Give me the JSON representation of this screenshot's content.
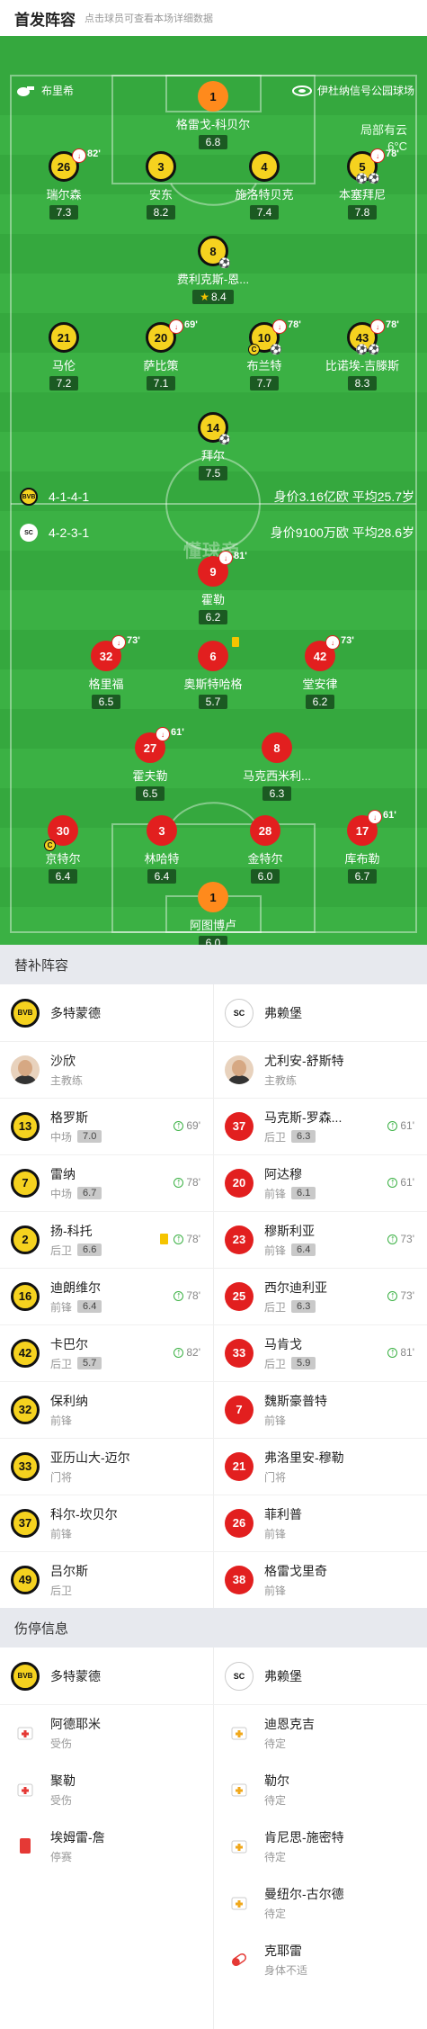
{
  "header": {
    "title": "首发阵容",
    "subtitle": "点击球员可查看本场详细数据"
  },
  "pitch": {
    "home_team": "布里希",
    "venue": "伊杜纳信号公园球场",
    "weather": "局部有云",
    "temperature": "6°C",
    "home_formation": "4-1-4-1",
    "away_formation": "4-2-3-1",
    "home_value": "身价3.16亿欧  平均25.7岁",
    "away_value": "身价9100万欧  平均28.6岁",
    "watermark": "懂球帝"
  },
  "dortmund": [
    {
      "num": "1",
      "name": "格雷戈-科贝尔",
      "rating": "6.8",
      "kind": "gk"
    },
    {
      "num": "26",
      "name": "瑞尔森",
      "rating": "7.3",
      "sub": "82'"
    },
    {
      "num": "3",
      "name": "安东",
      "rating": "8.2"
    },
    {
      "num": "4",
      "name": "施洛特贝克",
      "rating": "7.4"
    },
    {
      "num": "5",
      "name": "本塞拜尼",
      "rating": "7.8",
      "sub": "78'"
    },
    {
      "num": "8",
      "name": "费利克斯-恩...",
      "rating": "8.4"
    },
    {
      "num": "21",
      "name": "马伦",
      "rating": "7.2"
    },
    {
      "num": "20",
      "name": "萨比策",
      "rating": "7.1",
      "sub": "69'"
    },
    {
      "num": "10",
      "name": "布兰特",
      "rating": "7.7",
      "sub": "78'"
    },
    {
      "num": "43",
      "name": "比诺埃-吉滕斯",
      "rating": "8.3",
      "sub": "78'"
    },
    {
      "num": "14",
      "name": "拜尔",
      "rating": "7.5"
    }
  ],
  "freiburg": [
    {
      "num": "9",
      "name": "霍勒",
      "rating": "6.2",
      "sub": "81'"
    },
    {
      "num": "32",
      "name": "格里福",
      "rating": "6.5",
      "sub": "73'"
    },
    {
      "num": "6",
      "name": "奥斯特哈格",
      "rating": "5.7"
    },
    {
      "num": "42",
      "name": "堂安律",
      "rating": "6.2",
      "sub": "73'"
    },
    {
      "num": "27",
      "name": "霍夫勒",
      "rating": "6.5",
      "sub": "61'"
    },
    {
      "num": "8",
      "name": "马克西米利...",
      "rating": "6.3"
    },
    {
      "num": "30",
      "name": "京特尔",
      "rating": "6.4"
    },
    {
      "num": "3",
      "name": "林哈特",
      "rating": "6.4"
    },
    {
      "num": "28",
      "name": "金特尔",
      "rating": "6.0"
    },
    {
      "num": "17",
      "name": "库布勒",
      "rating": "6.7",
      "sub": "61'"
    },
    {
      "num": "1",
      "name": "阿图博卢",
      "rating": "6.0",
      "kind": "gk"
    }
  ],
  "subs_section": {
    "title": "替补阵容",
    "home_team": "多特蒙德",
    "away_team": "弗赖堡"
  },
  "coaches": [
    {
      "name": "沙欣",
      "role": "主教练"
    },
    {
      "name": "尤利安-舒斯特",
      "role": "主教练"
    }
  ],
  "subs_home": [
    {
      "num": "13",
      "name": "格罗斯",
      "pos": "中场",
      "rating": "7.0",
      "min": "69'"
    },
    {
      "num": "7",
      "name": "雷纳",
      "pos": "中场",
      "rating": "6.7",
      "min": "78'"
    },
    {
      "num": "2",
      "name": "扬-科托",
      "pos": "后卫",
      "rating": "6.6",
      "min": "78'",
      "card": true
    },
    {
      "num": "16",
      "name": "迪朗维尔",
      "pos": "前锋",
      "rating": "6.4",
      "min": "78'"
    },
    {
      "num": "42",
      "name": "卡巴尔",
      "pos": "后卫",
      "rating": "5.7",
      "min": "82'"
    },
    {
      "num": "32",
      "name": "保利纳",
      "pos": "前锋"
    },
    {
      "num": "33",
      "name": "亚历山大-迈尔",
      "pos": "门将"
    },
    {
      "num": "37",
      "name": "科尔-坎贝尔",
      "pos": "前锋"
    },
    {
      "num": "49",
      "name": "吕尔斯",
      "pos": "后卫"
    }
  ],
  "subs_away": [
    {
      "num": "37",
      "name": "马克斯-罗森...",
      "pos": "后卫",
      "rating": "6.3",
      "min": "61'"
    },
    {
      "num": "20",
      "name": "阿达穆",
      "pos": "前锋",
      "rating": "6.1",
      "min": "61'"
    },
    {
      "num": "23",
      "name": "穆斯利亚",
      "pos": "前锋",
      "rating": "6.4",
      "min": "73'"
    },
    {
      "num": "25",
      "name": "西尔迪利亚",
      "pos": "后卫",
      "rating": "6.3",
      "min": "73'"
    },
    {
      "num": "33",
      "name": "马肯戈",
      "pos": "后卫",
      "rating": "5.9",
      "min": "81'"
    },
    {
      "num": "7",
      "name": "魏斯豪普特",
      "pos": "前锋"
    },
    {
      "num": "21",
      "name": "弗洛里安-穆勒",
      "pos": "门将"
    },
    {
      "num": "26",
      "name": "菲利普",
      "pos": "前锋"
    },
    {
      "num": "38",
      "name": "格雷戈里奇",
      "pos": "前锋"
    }
  ],
  "injury_section": {
    "title": "伤停信息",
    "home_team": "多特蒙德",
    "away_team": "弗赖堡"
  },
  "injuries_home": [
    {
      "name": "阿德耶米",
      "status": "受伤",
      "icon": "medkit-red-icon"
    },
    {
      "name": "聚勒",
      "status": "受伤",
      "icon": "medkit-red-icon"
    },
    {
      "name": "埃姆雷-詹",
      "status": "停赛",
      "icon": "red-card-icon"
    }
  ],
  "injuries_away": [
    {
      "name": "迪恩克吉",
      "status": "待定",
      "icon": "medkit-yellow-icon"
    },
    {
      "name": "勒尔",
      "status": "待定",
      "icon": "medkit-yellow-icon"
    },
    {
      "name": "肯尼思-施密特",
      "status": "待定",
      "icon": "medkit-yellow-icon"
    },
    {
      "name": "曼纽尔-古尔德",
      "status": "待定",
      "icon": "medkit-yellow-icon"
    },
    {
      "name": "克耶雷",
      "status": "身体不适",
      "icon": "pill-icon"
    }
  ]
}
